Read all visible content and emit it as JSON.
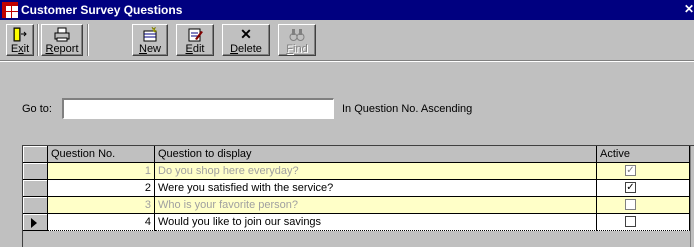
{
  "window": {
    "title": "Customer Survey Questions",
    "close_glyph": "✕"
  },
  "toolbar": {
    "exit": {
      "pre": "E",
      "u": "x",
      "post": "it",
      "icon": "exit-door-icon"
    },
    "report": {
      "pre": "",
      "u": "R",
      "post": "eport",
      "icon": "printer-icon"
    },
    "new": {
      "pre": "",
      "u": "N",
      "post": "ew",
      "icon": "new-record-icon"
    },
    "edit": {
      "pre": "",
      "u": "E",
      "post": "dit",
      "icon": "edit-record-icon"
    },
    "delete": {
      "pre": "",
      "u": "D",
      "post": "elete",
      "glyph": "✕",
      "icon": "delete-x-icon"
    },
    "find": {
      "pre": "",
      "u": "F",
      "post": "ind",
      "icon": "binoculars-icon",
      "enabled": false
    }
  },
  "goto": {
    "label": "Go to:",
    "value": "",
    "sort_text": "In Question No. Ascending"
  },
  "grid": {
    "columns": {
      "number": "Question No.",
      "question": "Question to display",
      "active": "Active"
    },
    "rows": [
      {
        "number": "1",
        "question": "Do you shop here everyday?",
        "active": true,
        "enabled": false,
        "check": "✓"
      },
      {
        "number": "2",
        "question": "Were you satisfied with the service?",
        "active": true,
        "enabled": true,
        "check": "✓"
      },
      {
        "number": "3",
        "question": "Who is your favorite person?",
        "active": false,
        "enabled": false,
        "check": ""
      },
      {
        "number": "4",
        "question": "Would you like to join our savings",
        "active": false,
        "enabled": true,
        "current": true,
        "check": ""
      }
    ]
  },
  "colors": {
    "titlebar": "#000080",
    "inactive_row": "#ffffc8",
    "inactive_text": "#a0a0a0"
  }
}
